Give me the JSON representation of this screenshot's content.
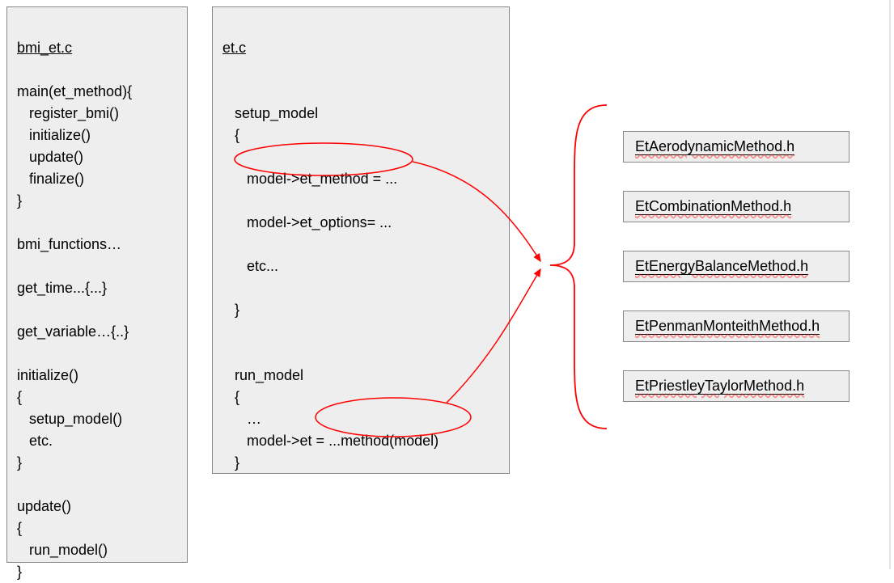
{
  "box1": {
    "title": "bmi_et.c",
    "code": "\n\nmain(et_method){\n   register_bmi()\n   initialize()\n   update()\n   finalize()\n}\n\nbmi_functions…\n\nget_time...{...}\n\nget_variable…{..}\n\ninitialize()\n{\n   setup_model()\n   etc.\n}\n\nupdate()\n{\n   run_model()\n}"
  },
  "box2": {
    "title": "et.c",
    "code": "\n\n\n   setup_model\n   {\n\n      model->et_method = ...\n\n      model->et_options= ...\n\n      etc...\n\n   }\n\n\n   run_model\n   {\n      …\n      model->et = ...method(model)\n   }"
  },
  "headers": [
    "EtAerodynamicMethod.h",
    "EtCombinationMethod.h",
    "EtEnergyBalanceMethod.h",
    "EtPenmanMonteithMethod.h",
    "EtPriestleyTaylorMethod.h"
  ]
}
